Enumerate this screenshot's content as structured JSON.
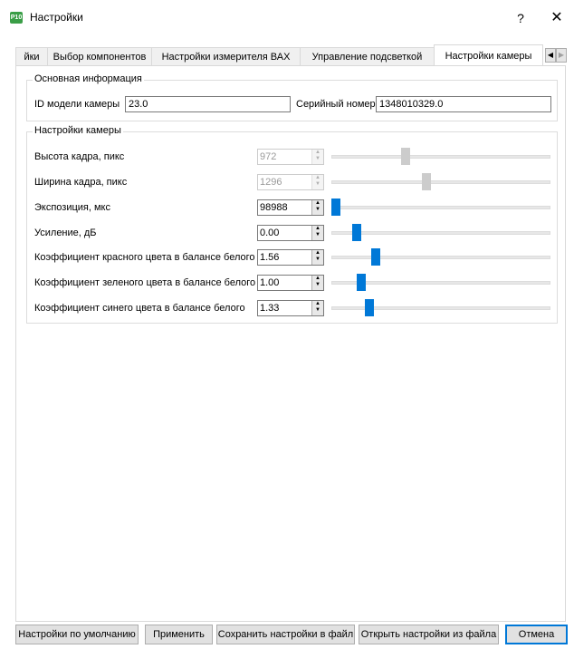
{
  "window": {
    "title": "Настройки",
    "icon_text": "P10",
    "help_label": "?",
    "close_label": "✕"
  },
  "tabs": [
    {
      "label": "йки"
    },
    {
      "label": "Выбор компонентов"
    },
    {
      "label": "Настройки измерителя ВАХ"
    },
    {
      "label": "Управление подсветкой"
    },
    {
      "label": "Настройки камеры",
      "active": true
    }
  ],
  "tab_scroll": {
    "left": "◀",
    "right": "▶"
  },
  "basic_info": {
    "title": "Основная информация",
    "model_id_label": "ID модели камеры",
    "model_id_value": "23.0",
    "serial_label": "Серийный номер",
    "serial_value": "1348010329.0"
  },
  "camera_settings": {
    "title": "Настройки камеры",
    "rows": [
      {
        "label": "Высота кадра, пикс",
        "value": "972",
        "enabled": false,
        "slider_pos": 0.33
      },
      {
        "label": "Ширина кадра, пикс",
        "value": "1296",
        "enabled": false,
        "slider_pos": 0.43
      },
      {
        "label": "Экспозиция, мкс",
        "value": "98988",
        "enabled": true,
        "slider_pos": 0.0
      },
      {
        "label": "Усиление, дБ",
        "value": "0.00",
        "enabled": true,
        "slider_pos": 0.1
      },
      {
        "label": "Коэффициент красного цвета в балансе белого",
        "value": "1.56",
        "enabled": true,
        "slider_pos": 0.19
      },
      {
        "label": "Коэффициент зеленого цвета в балансе белого",
        "value": "1.00",
        "enabled": true,
        "slider_pos": 0.12
      },
      {
        "label": "Коэффициент синего цвета в балансе белого",
        "value": "1.33",
        "enabled": true,
        "slider_pos": 0.16
      }
    ]
  },
  "buttons": {
    "defaults": "Настройки по умолчанию",
    "apply": "Применить",
    "save_file": "Сохранить настройки в файл",
    "open_file": "Открыть настройки из файла",
    "cancel": "Отмена"
  },
  "colors": {
    "accent": "#0078d7",
    "disabled": "#cccccc",
    "app_icon": "#3a9e47"
  }
}
